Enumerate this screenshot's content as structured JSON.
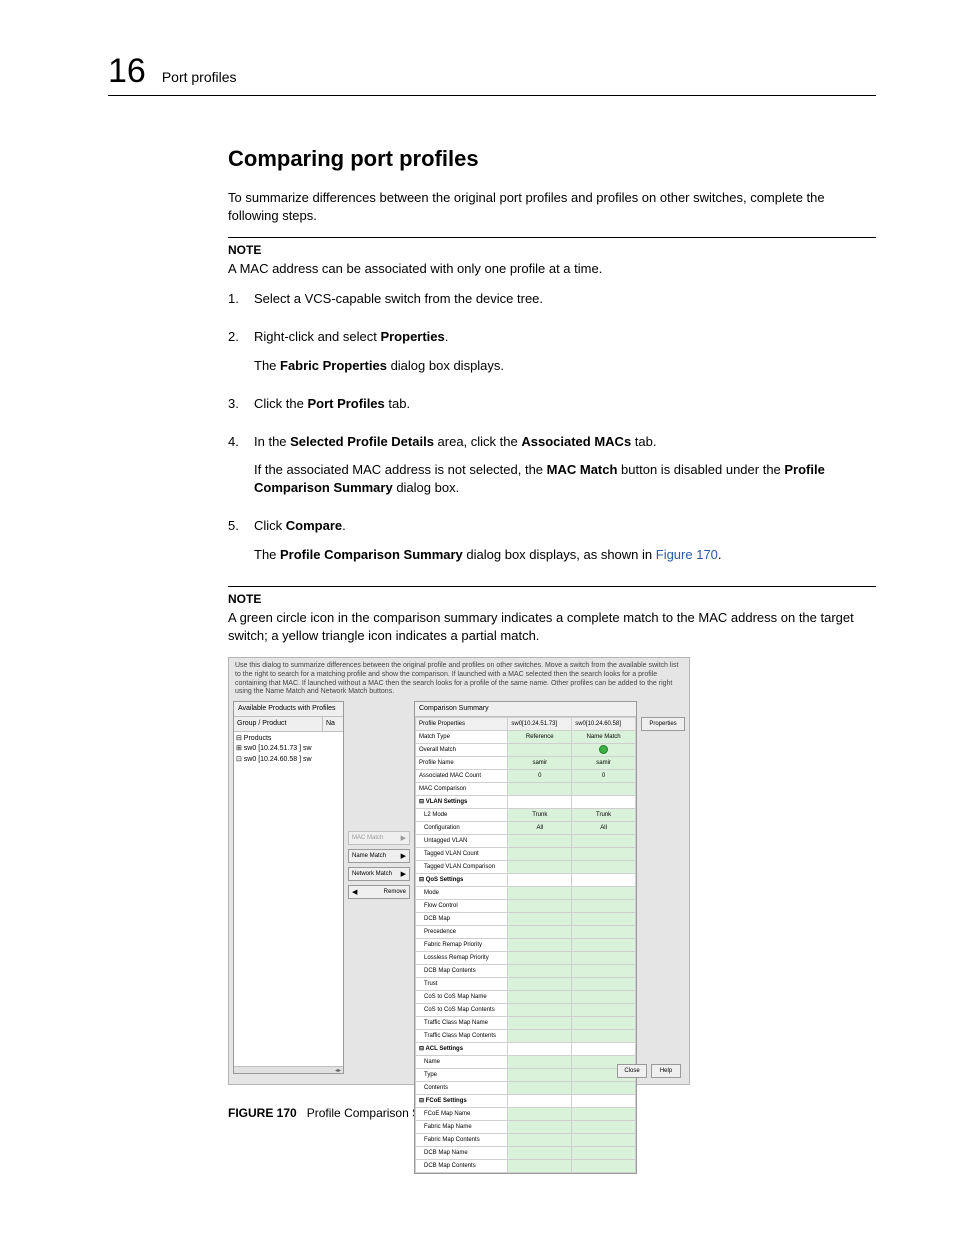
{
  "header": {
    "chapter_number": "16",
    "chapter_title": "Port profiles"
  },
  "section_title": "Comparing port profiles",
  "intro_para": "To summarize differences between the original port profiles and profiles on other switches, complete the following steps.",
  "note1": {
    "label": "NOTE",
    "text": "A MAC address can be associated with only one profile at a time."
  },
  "steps": {
    "s1": "Select a VCS-capable switch from the device tree.",
    "s2_a": "Right-click and select ",
    "s2_b": "Properties",
    "s2_c": ".",
    "s2_p_a": "The ",
    "s2_p_b": "Fabric Properties",
    "s2_p_c": " dialog box displays.",
    "s3_a": "Click the ",
    "s3_b": "Port Profiles",
    "s3_c": " tab.",
    "s4_a": "In the ",
    "s4_b": "Selected Profile Details",
    "s4_c": " area, click the ",
    "s4_d": "Associated MACs",
    "s4_e": " tab.",
    "s4_p_a": "If the associated MAC address is not selected, the ",
    "s4_p_b": "MAC Match",
    "s4_p_c": " button is disabled under the ",
    "s4_p_d": "Profile Comparison Summary",
    "s4_p_e": " dialog box.",
    "s5_a": "Click ",
    "s5_b": "Compare",
    "s5_c": ".",
    "s5_p_a": "The ",
    "s5_p_b": "Profile Comparison Summary",
    "s5_p_c": " dialog box displays, as shown in ",
    "s5_link": "Figure 170",
    "s5_p_d": "."
  },
  "note2": {
    "label": "NOTE",
    "text": "A green circle icon in the comparison summary indicates a complete match to the MAC address on the target switch; a yellow triangle icon indicates a partial match."
  },
  "dialog": {
    "desc": "Use this dialog to summarize differences between the original profile and profiles on other switches. Move a switch from the available switch list to the right to search for a matching profile and show the comparison. If launched with a MAC selected then the search looks for a profile containing that MAC. If launched without a MAC then the search looks for a profile of the same name. Other profiles can be added to the right using the Name Match and Network Match buttons.",
    "tree_title": "Available Products with Profiles",
    "tree_col1": "Group / Product",
    "tree_col2": "Na",
    "tree_rows": [
      "⊟  Products",
      "   ⊞  sw0 [10.24.51.73 ]   sw",
      "   ⊡  sw0 [10.24.60.58 ]   sw"
    ],
    "btn_mac": "MAC Match",
    "btn_name": "Name Match",
    "btn_net": "Network Match",
    "btn_remove": "Remove",
    "grid_title": "Comparison Summary",
    "grid_head": {
      "c1": "Profile Properties",
      "c2": "sw0[10.24.51.73]",
      "c3": "sw0[10.24.60.58]"
    },
    "rows": [
      {
        "l": "Match Type",
        "a": "Reference",
        "b": "Name Match",
        "s": false
      },
      {
        "l": "Overall Match",
        "a": "",
        "b": "__green__",
        "s": false
      },
      {
        "l": "Profile Name",
        "a": "samir",
        "b": "samir",
        "s": false
      },
      {
        "l": "Associated MAC Count",
        "a": "0",
        "b": "0",
        "s": false
      },
      {
        "l": "MAC Comparison",
        "a": "",
        "b": "",
        "s": false
      },
      {
        "l": "VLAN Settings",
        "a": "",
        "b": "",
        "s": true
      },
      {
        "l": "L2 Mode",
        "a": "Trunk",
        "b": "Trunk",
        "s": false,
        "i": 1
      },
      {
        "l": "Configuration",
        "a": "All",
        "b": "All",
        "s": false,
        "i": 1
      },
      {
        "l": "Untagged VLAN",
        "a": "",
        "b": "",
        "s": false,
        "i": 1
      },
      {
        "l": "Tagged VLAN Count",
        "a": "",
        "b": "",
        "s": false,
        "i": 1
      },
      {
        "l": "Tagged VLAN Comparison",
        "a": "",
        "b": "",
        "s": false,
        "i": 1
      },
      {
        "l": "QoS Settings",
        "a": "",
        "b": "",
        "s": true
      },
      {
        "l": "Mode",
        "a": "",
        "b": "",
        "s": false,
        "i": 1
      },
      {
        "l": "Flow Control",
        "a": "",
        "b": "",
        "s": false,
        "i": 1
      },
      {
        "l": "DCB Map",
        "a": "",
        "b": "",
        "s": false,
        "i": 1
      },
      {
        "l": "Precedence",
        "a": "",
        "b": "",
        "s": false,
        "i": 1
      },
      {
        "l": "Fabric Remap Priority",
        "a": "",
        "b": "",
        "s": false,
        "i": 1
      },
      {
        "l": "Lossless Remap Priority",
        "a": "",
        "b": "",
        "s": false,
        "i": 1
      },
      {
        "l": "DCB Map Contents",
        "a": "",
        "b": "",
        "s": false,
        "i": 1
      },
      {
        "l": "Trust",
        "a": "",
        "b": "",
        "s": false,
        "i": 1
      },
      {
        "l": "CoS to CoS Map Name",
        "a": "",
        "b": "",
        "s": false,
        "i": 1
      },
      {
        "l": "CoS to CoS Map Contents",
        "a": "",
        "b": "",
        "s": false,
        "i": 1
      },
      {
        "l": "Traffic Class Map Name",
        "a": "",
        "b": "",
        "s": false,
        "i": 1
      },
      {
        "l": "Traffic Class Map Contents",
        "a": "",
        "b": "",
        "s": false,
        "i": 1
      },
      {
        "l": "ACL Settings",
        "a": "",
        "b": "",
        "s": true
      },
      {
        "l": "Name",
        "a": "",
        "b": "",
        "s": false,
        "i": 1
      },
      {
        "l": "Type",
        "a": "",
        "b": "",
        "s": false,
        "i": 1
      },
      {
        "l": "Contents",
        "a": "",
        "b": "",
        "s": false,
        "i": 1
      },
      {
        "l": "FCoE Settings",
        "a": "",
        "b": "",
        "s": true
      },
      {
        "l": "FCoE Map Name",
        "a": "",
        "b": "",
        "s": false,
        "i": 1
      },
      {
        "l": "Fabric Map Name",
        "a": "",
        "b": "",
        "s": false,
        "i": 1
      },
      {
        "l": "Fabric Map Contents",
        "a": "",
        "b": "",
        "s": false,
        "i": 1
      },
      {
        "l": "DCB Map Name",
        "a": "",
        "b": "",
        "s": false,
        "i": 1
      },
      {
        "l": "DCB Map Contents",
        "a": "",
        "b": "",
        "s": false,
        "i": 1
      }
    ],
    "btn_props": "Properties",
    "btn_close": "Close",
    "btn_help": "Help"
  },
  "caption": {
    "lead": "FIGURE 170",
    "text": "Profile Comparison Summary dialog box"
  }
}
